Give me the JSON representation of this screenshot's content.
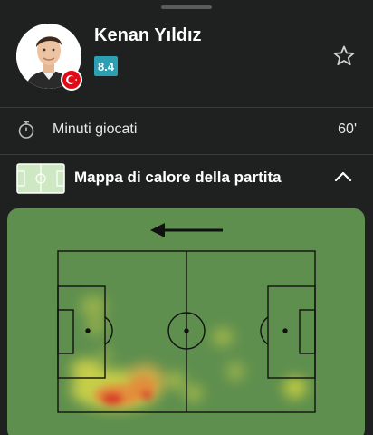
{
  "player": {
    "name": "Kenan Yıldız",
    "rating": "8.4",
    "nationality_flag": "turkey-flag",
    "avatar": "player-photo"
  },
  "stats": {
    "minutes_label": "Minuti giocati",
    "minutes_value": "60'"
  },
  "heatmap": {
    "title": "Mappa di calore della partita",
    "attack_direction": "left",
    "expanded": true
  },
  "colors": {
    "background": "#1f2020",
    "rating_badge": "#2c9fb2",
    "pitch": "#5f8f4e",
    "heat_low": "#d9d94a",
    "heat_high": "#d8392b"
  }
}
